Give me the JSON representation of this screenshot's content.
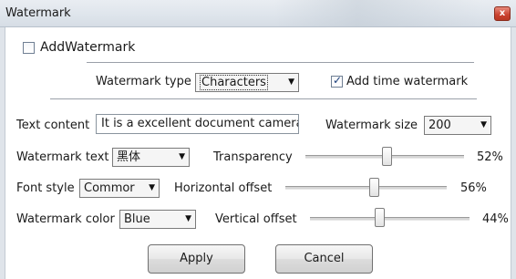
{
  "window": {
    "title": "Watermark",
    "close_label": "x"
  },
  "add_watermark": {
    "label": "AddWatermark",
    "checked": false
  },
  "watermark_type": {
    "label": "Watermark type",
    "value": "Characters"
  },
  "time_watermark": {
    "label": "Add time watermark",
    "checked": true
  },
  "text_content": {
    "label": "Text content",
    "value": "It is a excellent document camera"
  },
  "watermark_size": {
    "label": "Watermark size",
    "value": "200"
  },
  "watermark_text": {
    "label": "Watermark text",
    "value": "黑体"
  },
  "transparency": {
    "label": "Transparency",
    "value_text": "52%",
    "value": 0.52
  },
  "font_style": {
    "label": "Font style",
    "value": "Commor"
  },
  "horizontal_offset": {
    "label": "Horizontal offset",
    "value_text": "56%",
    "value": 0.56
  },
  "watermark_color": {
    "label": "Watermark color",
    "value": "Blue"
  },
  "vertical_offset": {
    "label": "Vertical offset",
    "value_text": "44%",
    "value": 0.44
  },
  "buttons": {
    "apply": "Apply",
    "cancel": "Cancel"
  },
  "icons": {
    "dropdown": "chevron-down-icon",
    "close": "close-icon",
    "check": "checkmark-icon"
  }
}
